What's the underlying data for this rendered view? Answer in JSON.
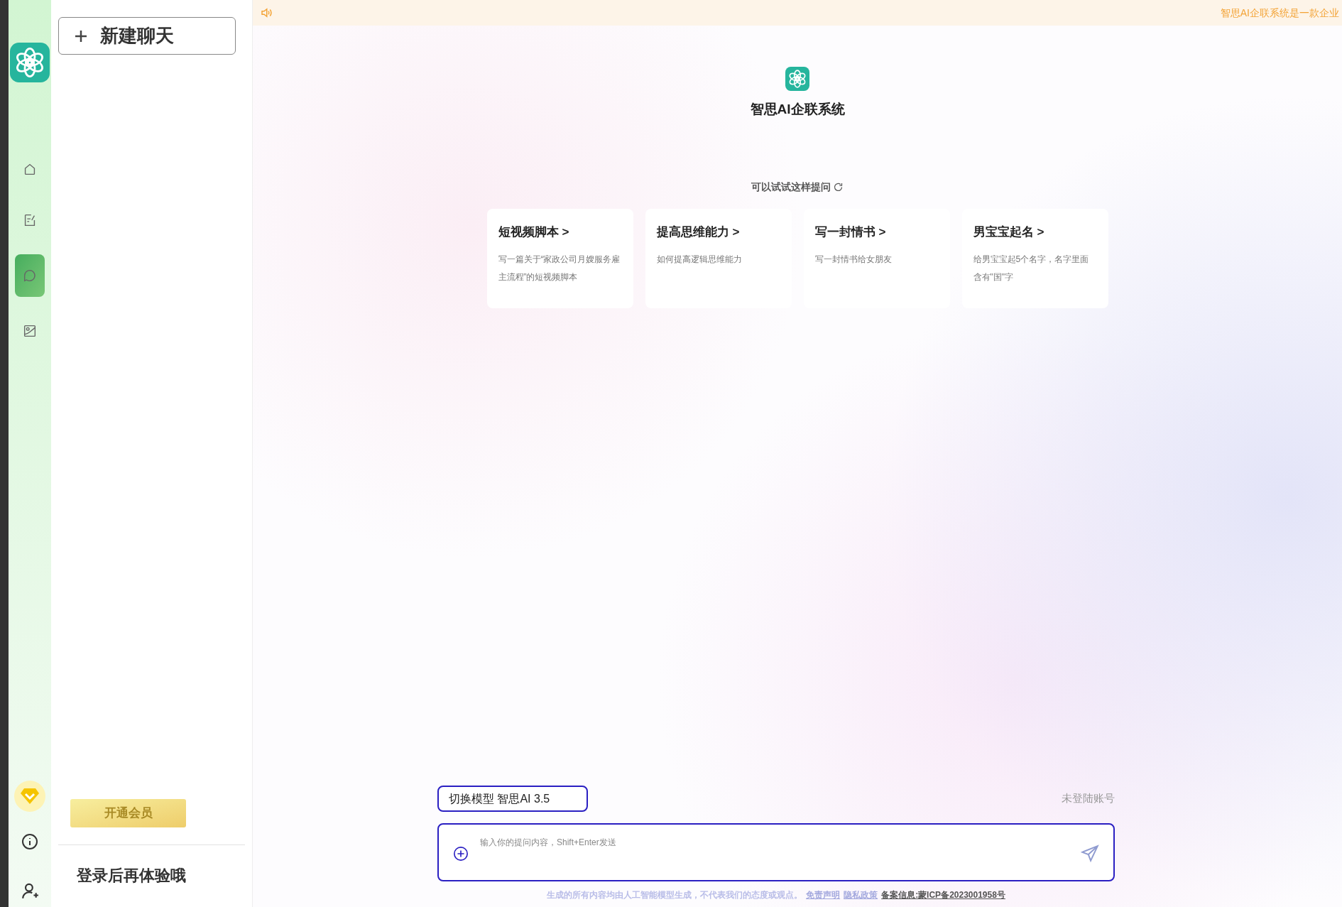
{
  "notice": {
    "text": "智思AI企联系统是一款企业"
  },
  "rail": {
    "items": [
      {
        "selected": false
      },
      {
        "selected": false
      },
      {
        "selected": true
      },
      {
        "selected": false
      }
    ]
  },
  "sidebar": {
    "new_chat": "新建聊天",
    "member_button": "开通会员",
    "login_hint": "登录后再体验哦"
  },
  "header": {
    "title": "智思AI企联系统"
  },
  "suggestions": {
    "heading": "可以试试这样提问",
    "cards": [
      {
        "title": "短视频脚本",
        "arrow": ">",
        "text": "写一篇关于“家政公司月嫂服务雇主流程”的短视频脚本"
      },
      {
        "title": "提高思维能力",
        "arrow": ">",
        "text": "如何提高逻辑思维能力"
      },
      {
        "title": "写一封情书",
        "arrow": ">",
        "text": "写一封情书给女朋友"
      },
      {
        "title": "男宝宝起名",
        "arrow": ">",
        "text": "给男宝宝起5个名字，名字里面含有\"国\"字"
      }
    ]
  },
  "composer": {
    "model_button": "切换模型 智思AI 3.5",
    "account": "未登陆账号",
    "placeholder": "输入你的提问内容，Shift+Enter发送"
  },
  "footer": {
    "disclaimer": "生成的所有内容均由人工智能模型生成，不代表我们的态度或观点。",
    "links": [
      "免责声明",
      "隐私政策",
      "备案信息:蒙ICP备2023001958号"
    ]
  }
}
